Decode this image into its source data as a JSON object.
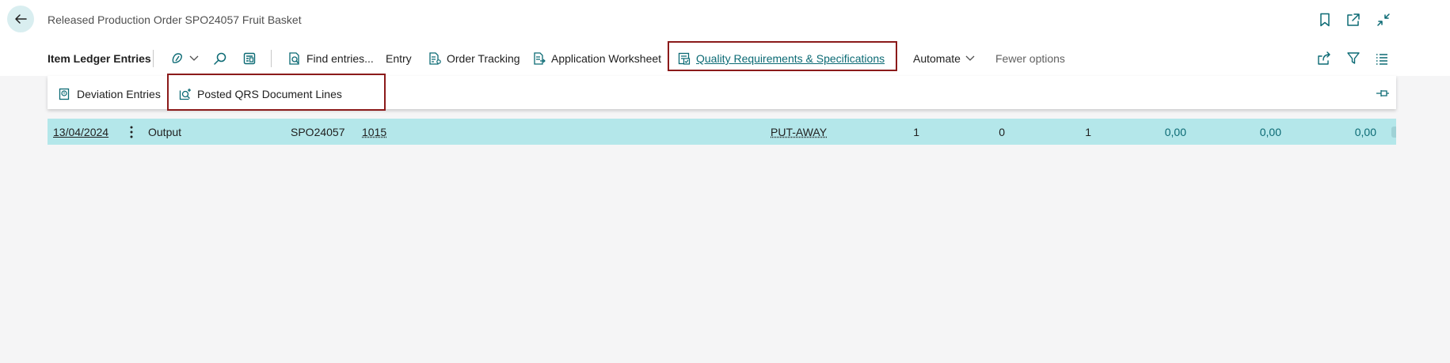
{
  "header": {
    "title": "Released Production Order SPO24057 Fruit Basket",
    "icons": [
      "back-arrow-icon",
      "bookmark-icon",
      "open-in-new-icon",
      "collapse-icon"
    ]
  },
  "toolbar": {
    "title": "Item Ledger Entries",
    "find_entries": "Find entries...",
    "entry": "Entry",
    "order_tracking": "Order Tracking",
    "application_worksheet": "Application Worksheet",
    "quality_req": "Quality Requirements & Specifications",
    "automate": "Automate",
    "fewer_options": "Fewer options"
  },
  "subactions": {
    "deviation_entries": "Deviation Entries",
    "posted_qrs": "Posted QRS Document Lines"
  },
  "row": {
    "date": "13/04/2024",
    "entry_type": "Output",
    "document_no": "SPO24057",
    "item_no": "1015",
    "location": "PUT-AWAY",
    "qty1": "1",
    "qty2": "0",
    "qty3": "1",
    "amt1": "0,00",
    "amt2": "0,00",
    "amt3": "0,00"
  },
  "colors": {
    "accent": "#0b6a74",
    "highlight_border": "#8b1a1a",
    "selected_row": "#b4e7ea"
  }
}
